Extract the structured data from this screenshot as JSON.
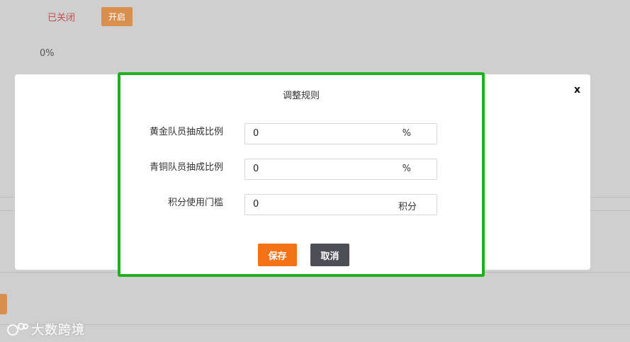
{
  "background": {
    "status_text": "已关闭",
    "open_button": "开启",
    "percent_text": "0%"
  },
  "watermark": {
    "text": "大数跨境"
  },
  "outer_modal": {
    "close_label": "x"
  },
  "dialog": {
    "title": "调整规则",
    "fields": [
      {
        "label": "黄金队员抽成比例",
        "value": "0",
        "unit": "%"
      },
      {
        "label": "青铜队员抽成比例",
        "value": "0",
        "unit": "%"
      },
      {
        "label": "积分使用门槛",
        "value": "0",
        "unit": "积分"
      }
    ],
    "save_label": "保存",
    "cancel_label": "取消"
  },
  "colors": {
    "highlight_border": "#1fb01f",
    "save_button": "#f47216",
    "cancel_button": "#4e4e56",
    "open_button": "#d9904f",
    "status_text": "#c0504d"
  }
}
